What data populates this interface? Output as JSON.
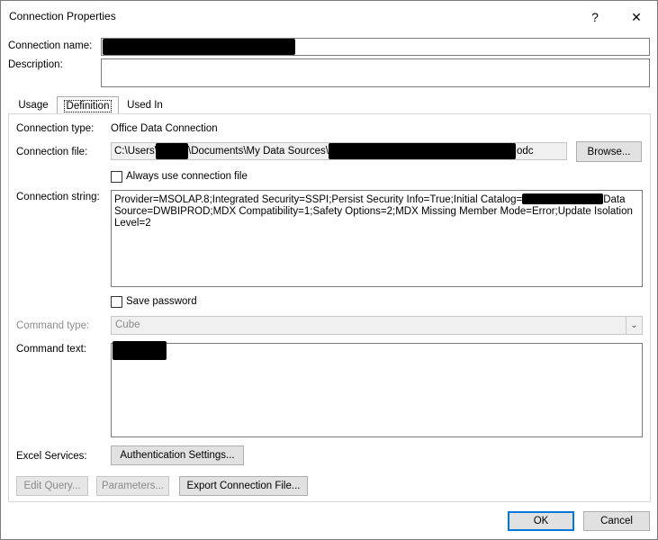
{
  "window": {
    "title": "Connection Properties",
    "help_glyph": "?",
    "close_glyph": "✕"
  },
  "connection_name": {
    "label": "Connection name:"
  },
  "description": {
    "label": "Description:"
  },
  "tabs": [
    {
      "label": "Usage"
    },
    {
      "label": "Definition"
    },
    {
      "label": "Used In"
    }
  ],
  "definition": {
    "connection_type": {
      "label": "Connection type:",
      "value": "Office Data Connection"
    },
    "connection_file": {
      "label": "Connection file:",
      "value_prefix": "C:\\Users\\",
      "value_middle": "\\Documents\\My Data Sources\\",
      "value_suffix": "odc",
      "browse_label": "Browse..."
    },
    "always_use_file": {
      "label": "Always use connection file",
      "checked": false
    },
    "connection_string": {
      "label": "Connection string:",
      "line1_a": "Provider=MSOLAP.8;Integrated Security=SSPI;Persist Security Info=True;Initial Catalog=",
      "line1_b": "Data",
      "line2": "Source=DWBIPROD;MDX Compatibility=1;Safety Options=2;MDX Missing Member Mode=Error;Update Isolation",
      "line3": "Level=2"
    },
    "save_password": {
      "label": "Save password",
      "checked": false
    },
    "command_type": {
      "label": "Command type:",
      "value": "Cube"
    },
    "command_text": {
      "label": "Command text:"
    },
    "excel_services": {
      "label": "Excel Services:",
      "button_label": "Authentication Settings..."
    }
  },
  "bottom_buttons": {
    "edit_query": "Edit Query...",
    "parameters": "Parameters...",
    "export": "Export Connection File..."
  },
  "footer": {
    "ok": "OK",
    "cancel": "Cancel"
  },
  "colors": {
    "accent": "#0078d7",
    "disabled_text": "#8a8a8a",
    "button_bg": "#e1e1e1"
  }
}
